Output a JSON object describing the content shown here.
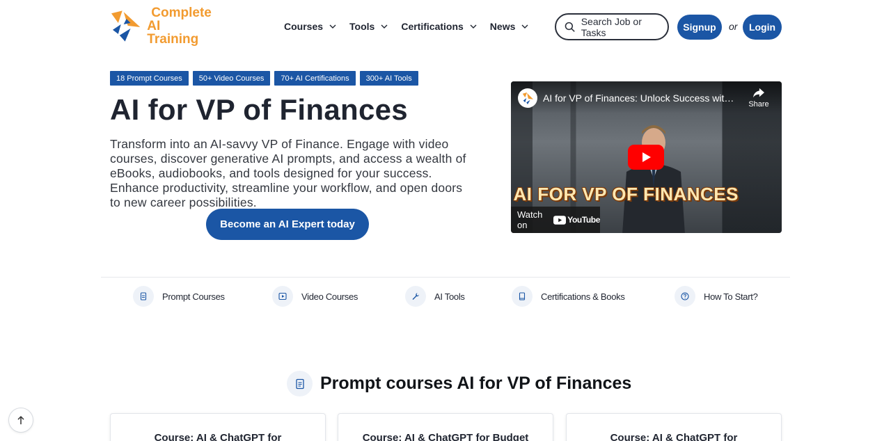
{
  "brand": {
    "line1": "Complete",
    "line2": "AI Training",
    "accent_color": "#f29b30",
    "primary_color": "#1b56a5"
  },
  "nav": {
    "items": [
      {
        "label": "Courses",
        "icon": "chevron-down-icon"
      },
      {
        "label": "Tools",
        "icon": "chevron-down-icon"
      },
      {
        "label": "Certifications",
        "icon": "chevron-down-icon"
      },
      {
        "label": "News",
        "icon": "chevron-down-icon"
      }
    ],
    "search_label": "Search Job or Tasks",
    "signup_label": "Signup",
    "or_label": "or",
    "login_label": "Login"
  },
  "hero": {
    "badges": [
      "18 Prompt Courses",
      "50+ Video Courses",
      "70+ AI Certifications",
      "300+ AI Tools"
    ],
    "title": "AI for VP of Finances",
    "description": "Transform into an AI-savvy VP of Finance. Engage with video courses, discover generative AI prompts, and access a wealth of eBooks, audiobooks, and tools designed for your success. Enhance productivity, streamline your workflow, and open doors to new career possibilities.",
    "cta_label": "Become an AI Expert today"
  },
  "video": {
    "title": "AI for VP of Finances: Unlock Success with P...",
    "share_label": "Share",
    "overlay_text": "AI FOR VP OF FINANCES",
    "watch_on_label": "Watch on",
    "youtube_label": "YouTube"
  },
  "quick_links": [
    {
      "label": "Prompt Courses",
      "icon": "document-icon"
    },
    {
      "label": "Video Courses",
      "icon": "play-icon"
    },
    {
      "label": "AI Tools",
      "icon": "wrench-icon"
    },
    {
      "label": "Certifications & Books",
      "icon": "book-icon"
    },
    {
      "label": "How To Start?",
      "icon": "help-icon"
    }
  ],
  "section": {
    "title": "Prompt courses AI for VP of Finances",
    "icon": "document-icon",
    "cards": [
      {
        "title": "Course: AI & ChatGPT for"
      },
      {
        "title": "Course: AI & ChatGPT for Budget"
      },
      {
        "title": "Course: AI & ChatGPT for"
      }
    ]
  }
}
